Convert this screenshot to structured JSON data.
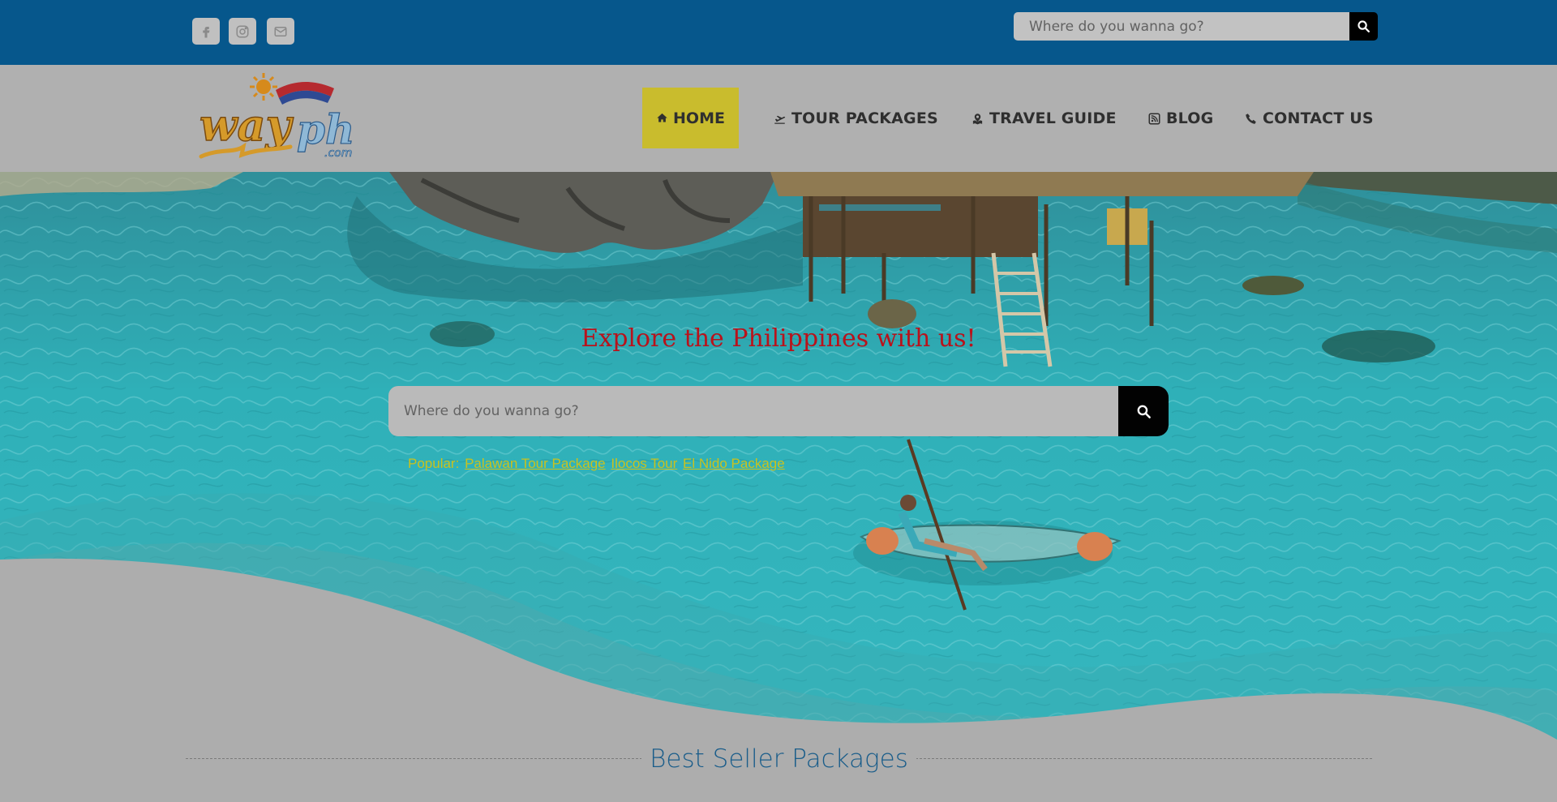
{
  "topbar": {
    "socials": [
      {
        "name": "facebook",
        "icon": "facebook-icon"
      },
      {
        "name": "instagram",
        "icon": "instagram-icon"
      },
      {
        "name": "email",
        "icon": "envelope-icon"
      }
    ],
    "search": {
      "placeholder": "Where do you wanna go?",
      "button_icon": "search-icon"
    }
  },
  "header": {
    "logo": {
      "main": "way",
      "accent": "ph",
      "suffix": ".com"
    },
    "nav": [
      {
        "label": "HOME",
        "icon": "home-icon",
        "active": true
      },
      {
        "label": "TOUR PACKAGES",
        "icon": "plane-icon"
      },
      {
        "label": "TRAVEL GUIDE",
        "icon": "map-marker-icon"
      },
      {
        "label": "BLOG",
        "icon": "rss-icon"
      },
      {
        "label": "CONTACT US",
        "icon": "phone-icon"
      }
    ]
  },
  "hero": {
    "title": "Explore the Philippines with us!",
    "search": {
      "placeholder": "Where do you wanna go?",
      "button_icon": "search-icon"
    },
    "popular": {
      "label": "Popular:",
      "links": [
        "Palawan Tour Package",
        "Ilocos Tour",
        "El Nido Package"
      ]
    }
  },
  "section": {
    "title": "Best Seller Packages"
  },
  "colors": {
    "topbar": "#06578c",
    "header": "#b0b0b0",
    "active_nav": "#c9bc2d",
    "hero_title": "#b9121b",
    "popular": "#c9c21e",
    "section_title": "#1a5d8a",
    "water": "#2aa8b0"
  }
}
